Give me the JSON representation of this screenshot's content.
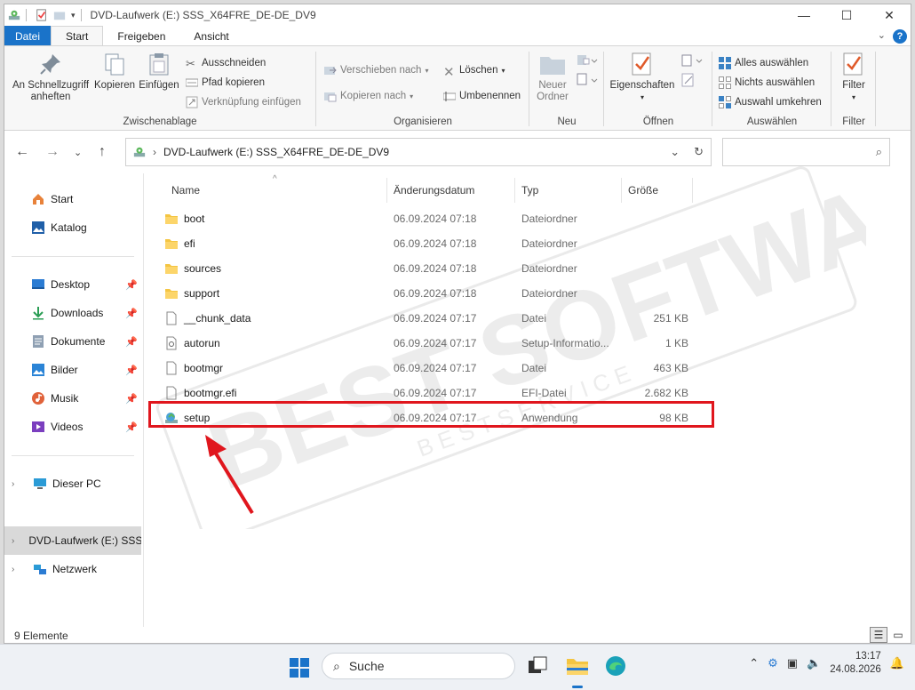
{
  "window": {
    "title": "DVD-Laufwerk (E:) SSS_X64FRE_DE-DE_DV9",
    "controls": {
      "minimize": "—",
      "maximize": "☐",
      "close": "✕"
    }
  },
  "tabs": [
    {
      "label": "Datei"
    },
    {
      "label": "Start"
    },
    {
      "label": "Freigeben"
    },
    {
      "label": "Ansicht"
    }
  ],
  "ribbon": {
    "clipboard": {
      "label": "Zwischenablage",
      "pin_line1": "An Schnellzugriff",
      "pin_line2": "anheften",
      "copy": "Kopieren",
      "paste": "Einfügen",
      "cut": "Ausschneiden",
      "copy_path": "Pfad kopieren",
      "paste_shortcut": "Verknüpfung einfügen"
    },
    "organize": {
      "label": "Organisieren",
      "move_to": "Verschieben nach",
      "copy_to": "Kopieren nach",
      "delete": "Löschen",
      "rename": "Umbenennen"
    },
    "new": {
      "label": "Neu",
      "new_folder_line1": "Neuer",
      "new_folder_line2": "Ordner"
    },
    "open": {
      "label": "Öffnen",
      "properties": "Eigenschaften"
    },
    "select": {
      "label": "Auswählen",
      "select_all": "Alles auswählen",
      "select_none": "Nichts auswählen",
      "invert": "Auswahl umkehren"
    },
    "filter": {
      "label": "Filter",
      "button": "Filter"
    }
  },
  "address": {
    "path": "DVD-Laufwerk (E:) SSS_X64FRE_DE-DE_DV9",
    "search_placeholder": ""
  },
  "nav_pane": {
    "items": [
      {
        "label": "Start"
      },
      {
        "label": "Katalog"
      },
      {
        "label": "Desktop"
      },
      {
        "label": "Downloads"
      },
      {
        "label": "Dokumente"
      },
      {
        "label": "Bilder"
      },
      {
        "label": "Musik"
      },
      {
        "label": "Videos"
      },
      {
        "label": "Dieser PC"
      },
      {
        "label": "DVD-Laufwerk (E:) SSS"
      },
      {
        "label": "Netzwerk"
      }
    ]
  },
  "columns": {
    "name": "Name",
    "date": "Änderungsdatum",
    "type": "Typ",
    "size": "Größe"
  },
  "files": [
    {
      "name": "boot",
      "date": "06.09.2024 07:18",
      "type": "Dateiordner",
      "size": ""
    },
    {
      "name": "efi",
      "date": "06.09.2024 07:18",
      "type": "Dateiordner",
      "size": ""
    },
    {
      "name": "sources",
      "date": "06.09.2024 07:18",
      "type": "Dateiordner",
      "size": ""
    },
    {
      "name": "support",
      "date": "06.09.2024 07:18",
      "type": "Dateiordner",
      "size": ""
    },
    {
      "name": "__chunk_data",
      "date": "06.09.2024 07:17",
      "type": "Datei",
      "size": "251 KB"
    },
    {
      "name": "autorun",
      "date": "06.09.2024 07:17",
      "type": "Setup-Informatio...",
      "size": "1 KB"
    },
    {
      "name": "bootmgr",
      "date": "06.09.2024 07:17",
      "type": "Datei",
      "size": "463 KB"
    },
    {
      "name": "bootmgr.efi",
      "date": "06.09.2024 07:17",
      "type": "EFI-Datei",
      "size": "2.682 KB"
    },
    {
      "name": "setup",
      "date": "06.09.2024 07:17",
      "type": "Anwendung",
      "size": "98 KB"
    }
  ],
  "status": {
    "count": "9 Elemente"
  },
  "taskbar": {
    "search_label": "Suche",
    "time": "13:17",
    "date": "24.08.2026"
  },
  "watermark": {
    "line1": "BEST SOFTWARE",
    "line2": "B E S T   S E R V I C E"
  },
  "colors": {
    "accent": "#1a73c9",
    "highlight": "#e0161d",
    "folder": "#f4c542"
  }
}
